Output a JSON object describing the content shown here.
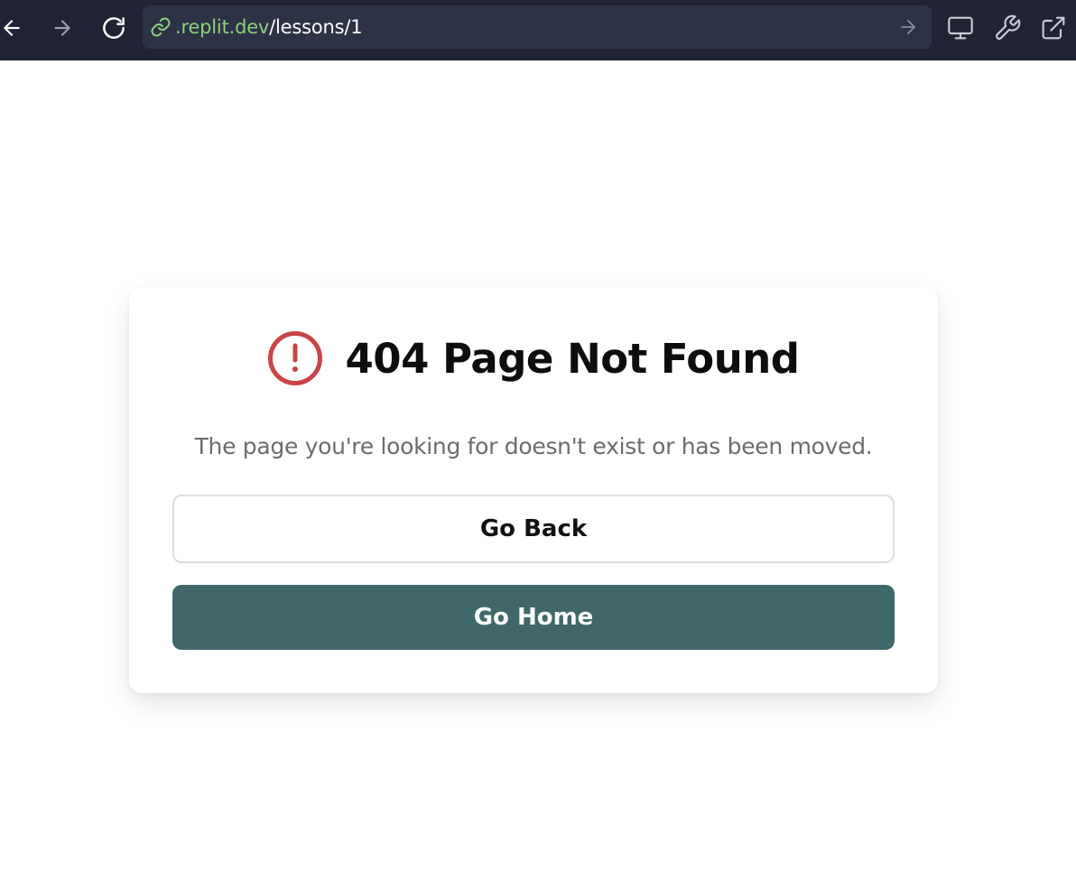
{
  "browser": {
    "url_host": ".replit.dev",
    "url_path": "/lessons/1",
    "icons": [
      "back-arrow-icon",
      "forward-arrow-icon",
      "reload-icon",
      "link-icon",
      "go-arrow-icon",
      "monitor-icon",
      "wrench-icon",
      "external-link-icon"
    ]
  },
  "page": {
    "title": "404 Page Not Found",
    "message": "The page you're looking for doesn't exist or has been moved.",
    "back_label": "Go Back",
    "home_label": "Go Home"
  },
  "colors": {
    "toolbar_bg": "#1f2333",
    "url_bar_bg": "#2d3246",
    "url_host": "#8bd17c",
    "alert_red": "#c94444",
    "primary_button": "#40686a"
  }
}
